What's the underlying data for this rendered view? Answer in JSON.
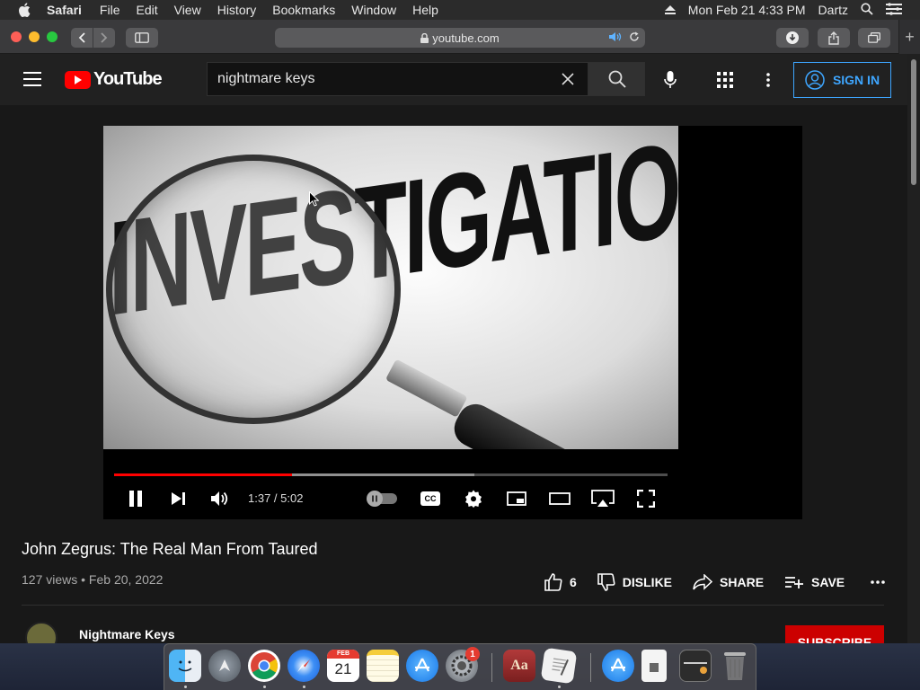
{
  "menubar": {
    "app_name": "Safari",
    "items": [
      "File",
      "Edit",
      "View",
      "History",
      "Bookmarks",
      "Window",
      "Help"
    ],
    "clock": "Mon Feb 21  4:33 PM",
    "user": "Dartz"
  },
  "browser": {
    "address": "youtube.com"
  },
  "youtube": {
    "search_query": "nightmare keys",
    "sign_in_label": "SIGN IN",
    "video": {
      "image_text": "INVESTIGATION",
      "time_display": "1:37 / 5:02",
      "progress_played": 0.322,
      "progress_buffered": 0.651,
      "cc_label": "CC"
    },
    "title": "John Zegrus: The Real Man From Taured",
    "meta": "127 views • Feb 20, 2022",
    "likes": "6",
    "dislike_label": "DISLIKE",
    "share_label": "SHARE",
    "save_label": "SAVE",
    "channel_name": "Nightmare Keys",
    "subscribe_label": "SUBSCRIBE"
  },
  "dock": {
    "calendar_month": "FEB",
    "calendar_day": "21",
    "dictionary_label": "Aa",
    "notification_badge": "1"
  },
  "colors": {
    "accent_blue": "#3ea6ff",
    "youtube_red": "#ff0000",
    "subscribe_red": "#cc0000"
  }
}
